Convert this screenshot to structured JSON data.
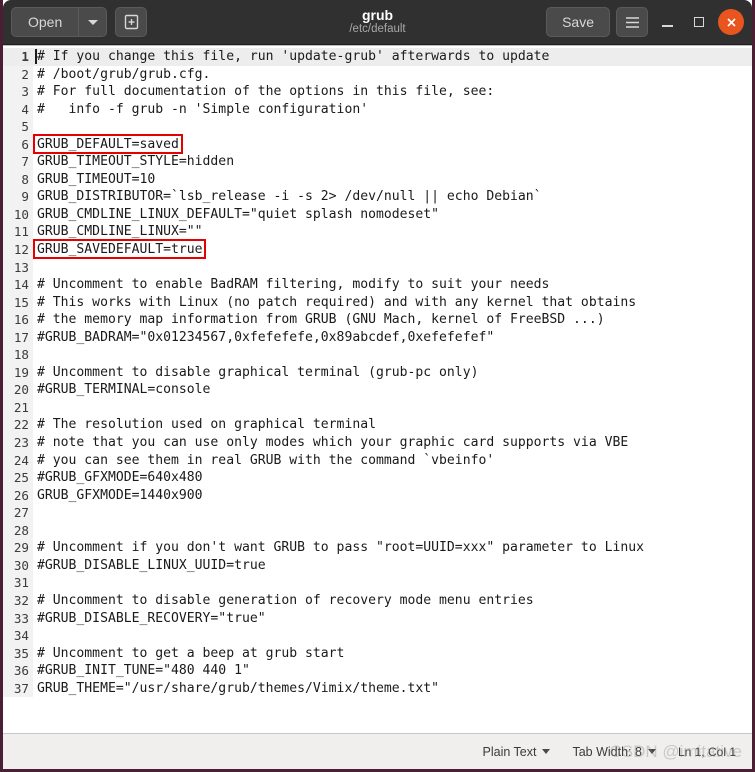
{
  "window": {
    "title": "grub",
    "subtitle": "/etc/default"
  },
  "toolbar": {
    "open_label": "Open",
    "open_dropdown_label": "▾",
    "new_document_label": "+",
    "save_label": "Save",
    "menu_label": "☰",
    "minimize_label": "",
    "maximize_label": "",
    "close_label": "✕"
  },
  "statusbar": {
    "language": "Plain Text",
    "tab_width": "Tab Width: 8",
    "position": "Ln 1, Col 1",
    "watermark": "CSDN @imitative"
  },
  "editor": {
    "current_line": 1,
    "highlight_color": "#e60000",
    "highlighted_lines": [
      6,
      12
    ],
    "lines": [
      {
        "n": "1",
        "text": "# If you change this file, run 'update-grub' afterwards to update"
      },
      {
        "n": "2",
        "text": "# /boot/grub/grub.cfg."
      },
      {
        "n": "3",
        "text": "# For full documentation of the options in this file, see:"
      },
      {
        "n": "4",
        "text": "#   info -f grub -n 'Simple configuration'"
      },
      {
        "n": "5",
        "text": ""
      },
      {
        "n": "6",
        "text": "GRUB_DEFAULT=saved"
      },
      {
        "n": "7",
        "text": "GRUB_TIMEOUT_STYLE=hidden"
      },
      {
        "n": "8",
        "text": "GRUB_TIMEOUT=10"
      },
      {
        "n": "9",
        "text": "GRUB_DISTRIBUTOR=`lsb_release -i -s 2> /dev/null || echo Debian`"
      },
      {
        "n": "10",
        "text": "GRUB_CMDLINE_LINUX_DEFAULT=\"quiet splash nomodeset\""
      },
      {
        "n": "11",
        "text": "GRUB_CMDLINE_LINUX=\"\""
      },
      {
        "n": "12",
        "text": "GRUB_SAVEDEFAULT=true"
      },
      {
        "n": "13",
        "text": ""
      },
      {
        "n": "14",
        "text": "# Uncomment to enable BadRAM filtering, modify to suit your needs"
      },
      {
        "n": "15",
        "text": "# This works with Linux (no patch required) and with any kernel that obtains"
      },
      {
        "n": "16",
        "text": "# the memory map information from GRUB (GNU Mach, kernel of FreeBSD ...)"
      },
      {
        "n": "17",
        "text": "#GRUB_BADRAM=\"0x01234567,0xfefefefe,0x89abcdef,0xefefefef\""
      },
      {
        "n": "18",
        "text": ""
      },
      {
        "n": "19",
        "text": "# Uncomment to disable graphical terminal (grub-pc only)"
      },
      {
        "n": "20",
        "text": "#GRUB_TERMINAL=console"
      },
      {
        "n": "21",
        "text": ""
      },
      {
        "n": "22",
        "text": "# The resolution used on graphical terminal"
      },
      {
        "n": "23",
        "text": "# note that you can use only modes which your graphic card supports via VBE"
      },
      {
        "n": "24",
        "text": "# you can see them in real GRUB with the command `vbeinfo'"
      },
      {
        "n": "25",
        "text": "#GRUB_GFXMODE=640x480"
      },
      {
        "n": "26",
        "text": "GRUB_GFXMODE=1440x900"
      },
      {
        "n": "27",
        "text": ""
      },
      {
        "n": "28",
        "text": ""
      },
      {
        "n": "29",
        "text": "# Uncomment if you don't want GRUB to pass \"root=UUID=xxx\" parameter to Linux"
      },
      {
        "n": "30",
        "text": "#GRUB_DISABLE_LINUX_UUID=true"
      },
      {
        "n": "31",
        "text": ""
      },
      {
        "n": "32",
        "text": "# Uncomment to disable generation of recovery mode menu entries"
      },
      {
        "n": "33",
        "text": "#GRUB_DISABLE_RECOVERY=\"true\""
      },
      {
        "n": "34",
        "text": ""
      },
      {
        "n": "35",
        "text": "# Uncomment to get a beep at grub start"
      },
      {
        "n": "36",
        "text": "#GRUB_INIT_TUNE=\"480 440 1\""
      },
      {
        "n": "37",
        "text": "GRUB_THEME=\"/usr/share/grub/themes/Vimix/theme.txt\""
      }
    ]
  }
}
